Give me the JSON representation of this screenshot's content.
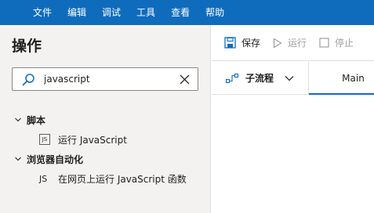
{
  "menu": [
    "文件",
    "编辑",
    "调试",
    "工具",
    "查看",
    "帮助"
  ],
  "panel": {
    "title": "操作",
    "search": {
      "value": "javascript",
      "placeholder": ""
    }
  },
  "tree": {
    "groups": [
      {
        "label": "脚本",
        "items": [
          {
            "label": "运行 JavaScript",
            "icon": "JS"
          }
        ]
      },
      {
        "label": "浏览器自动化",
        "items": [
          {
            "label": "在网页上运行 JavaScript 函数",
            "icon": "JS"
          }
        ]
      }
    ]
  },
  "toolbar": {
    "save": "保存",
    "run": "运行",
    "stop": "停止"
  },
  "tabs": {
    "subflow": "子流程",
    "main": "Main"
  },
  "colors": {
    "accent": "#0f6cbd",
    "panel_bg": "#f3f2f1"
  }
}
